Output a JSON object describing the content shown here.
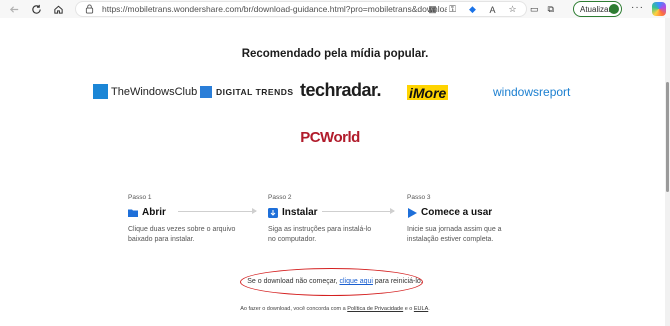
{
  "browser": {
    "url": "https://mobiletrans.wondershare.com/br/download-guidance.html?pro=mobiletrans&download_url...",
    "update_label": "Atualizar"
  },
  "page": {
    "heading": "Recomendado pela mídia popular.",
    "logos": {
      "twc": "TheWindowsClub",
      "dt": "DIGITAL TRENDS",
      "tr": "techradar.",
      "im": "iMore",
      "wr": "windowsreport",
      "pc": "PCWorld"
    },
    "steps": [
      {
        "num": "Passo 1",
        "title": "Abrir",
        "desc": "Clique duas vezes sobre o arquivo baixado para instalar.",
        "icon": "folder-icon"
      },
      {
        "num": "Passo 2",
        "title": "Instalar",
        "desc": "Siga as instruções para instalá-lo no computador.",
        "icon": "download-icon"
      },
      {
        "num": "Passo 3",
        "title": "Comece a usar",
        "desc": "Inicie sua jornada assim que a instalação estiver completa.",
        "icon": "play-icon"
      }
    ],
    "retry": {
      "before": "Se o download não começar, ",
      "link": "clique aqui",
      "after": " para reiniciá-lo."
    },
    "legal": {
      "before": "Ao fazer o download, você concorda com a ",
      "privacy": "Política de Privacidade",
      "middle": " e o ",
      "eula": "EULA",
      "after": "."
    }
  },
  "colors": {
    "accent": "#1a5fd0",
    "annotation": "#d42020",
    "pcworld": "#b11b2b"
  }
}
